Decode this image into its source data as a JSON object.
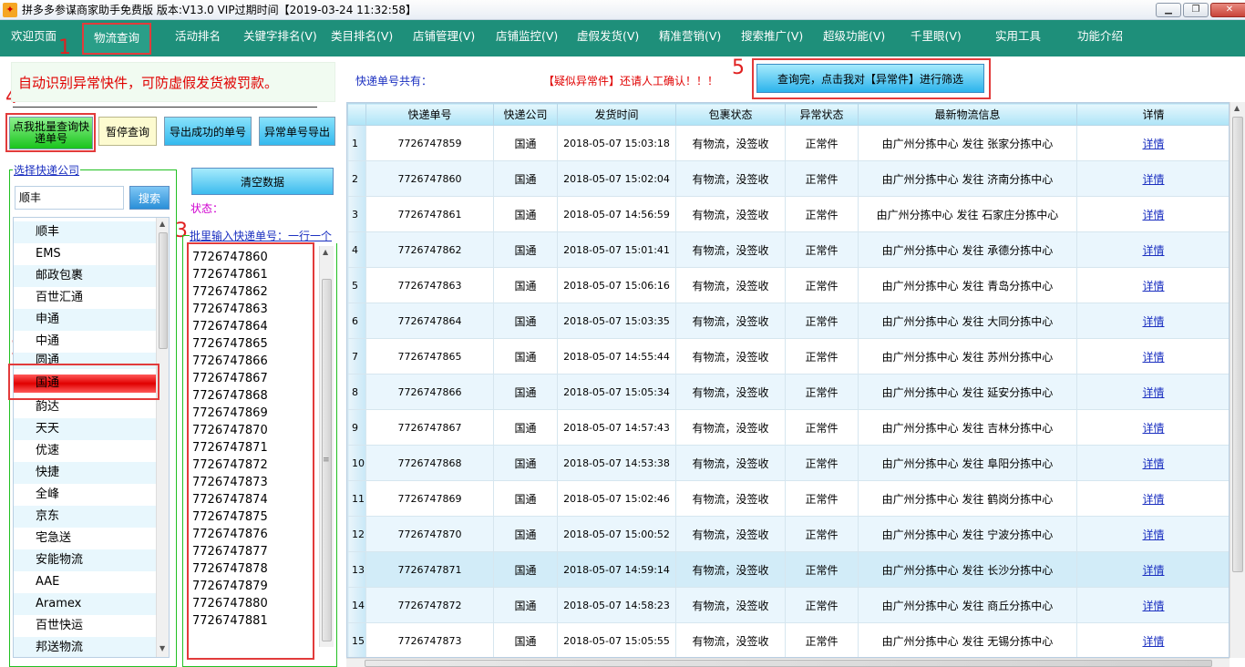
{
  "window": {
    "title": "拼多多参谋商家助手免费版 版本:V13.0 VIP过期时间【2019-03-24 11:32:58】",
    "icon": "app-icon"
  },
  "menu": {
    "items": [
      "欢迎页面",
      "物流查询",
      "活动排名",
      "关键字排名(V)",
      "类目排名(V)",
      "店铺管理(V)",
      "店铺监控(V)",
      "虚假发货(V)",
      "精准营销(V)",
      "搜索推广(V)",
      "超级功能(V)",
      "千里眼(V)",
      "实用工具",
      "功能介绍"
    ],
    "active": "物流查询"
  },
  "markers": [
    "1",
    "2",
    "3",
    "4",
    "5"
  ],
  "tip": "自动识别异常快件，可防虚假发货被罚款。",
  "buttons": {
    "batch_query": "点我批量查询快递单号",
    "pause": "暂停查询",
    "export_success": "导出成功的单号",
    "export_abnormal": "异常单号导出",
    "clear": "清空数据",
    "search": "搜索",
    "filter": "查询完，点击我对【异常件】进行筛选"
  },
  "courier_group": {
    "label": "选择快递公司",
    "search_value": "顺丰",
    "items": [
      "顺丰",
      "EMS",
      "邮政包裹",
      "百世汇通",
      "申通",
      "中通",
      "圆通",
      "国通",
      "韵达",
      "天天",
      "优速",
      "快捷",
      "全峰",
      "京东",
      "宅急送",
      "安能物流",
      "AAE",
      "Aramex",
      "百世快运",
      "邦送物流"
    ],
    "selected": "国通"
  },
  "status_label": "状态：",
  "input_group": {
    "label": "批里输入快递单号：一行一个",
    "numbers": [
      "7726747860",
      "7726747861",
      "7726747862",
      "7726747863",
      "7726747864",
      "7726747865",
      "7726747866",
      "7726747867",
      "7726747868",
      "7726747869",
      "7726747870",
      "7726747871",
      "7726747872",
      "7726747873",
      "7726747874",
      "7726747875",
      "7726747876",
      "7726747877",
      "7726747878",
      "7726747879",
      "7726747880",
      "7726747881"
    ]
  },
  "count_label": "快递单号共有：",
  "warning": "【疑似异常件】还请人工确认！！！",
  "table": {
    "headers": [
      "",
      "快递单号",
      "快递公司",
      "发货时间",
      "包裹状态",
      "异常状态",
      "最新物流信息",
      "详情"
    ],
    "rows": [
      [
        "1",
        "7726747859",
        "国通",
        "2018-05-07 15:03:18",
        "有物流，没签收",
        "正常件",
        "由广州分拣中心 发往 张家分拣中心",
        "详情"
      ],
      [
        "2",
        "7726747860",
        "国通",
        "2018-05-07 15:02:04",
        "有物流，没签收",
        "正常件",
        "由广州分拣中心 发往 济南分拣中心",
        "详情"
      ],
      [
        "3",
        "7726747861",
        "国通",
        "2018-05-07 14:56:59",
        "有物流，没签收",
        "正常件",
        "由广州分拣中心 发往 石家庄分拣中心",
        "详情"
      ],
      [
        "4",
        "7726747862",
        "国通",
        "2018-05-07 15:01:41",
        "有物流，没签收",
        "正常件",
        "由广州分拣中心 发往 承德分拣中心",
        "详情"
      ],
      [
        "5",
        "7726747863",
        "国通",
        "2018-05-07 15:06:16",
        "有物流，没签收",
        "正常件",
        "由广州分拣中心 发往 青岛分拣中心",
        "详情"
      ],
      [
        "6",
        "7726747864",
        "国通",
        "2018-05-07 15:03:35",
        "有物流，没签收",
        "正常件",
        "由广州分拣中心 发往 大同分拣中心",
        "详情"
      ],
      [
        "7",
        "7726747865",
        "国通",
        "2018-05-07 14:55:44",
        "有物流，没签收",
        "正常件",
        "由广州分拣中心 发往 苏州分拣中心",
        "详情"
      ],
      [
        "8",
        "7726747866",
        "国通",
        "2018-05-07 15:05:34",
        "有物流，没签收",
        "正常件",
        "由广州分拣中心 发往 延安分拣中心",
        "详情"
      ],
      [
        "9",
        "7726747867",
        "国通",
        "2018-05-07 14:57:43",
        "有物流，没签收",
        "正常件",
        "由广州分拣中心 发往 吉林分拣中心",
        "详情"
      ],
      [
        "10",
        "7726747868",
        "国通",
        "2018-05-07 14:53:38",
        "有物流，没签收",
        "正常件",
        "由广州分拣中心 发往 阜阳分拣中心",
        "详情"
      ],
      [
        "11",
        "7726747869",
        "国通",
        "2018-05-07 15:02:46",
        "有物流，没签收",
        "正常件",
        "由广州分拣中心 发往 鹤岗分拣中心",
        "详情"
      ],
      [
        "12",
        "7726747870",
        "国通",
        "2018-05-07 15:00:52",
        "有物流，没签收",
        "正常件",
        "由广州分拣中心 发往 宁波分拣中心",
        "详情"
      ],
      [
        "13",
        "7726747871",
        "国通",
        "2018-05-07 14:59:14",
        "有物流，没签收",
        "正常件",
        "由广州分拣中心 发往 长沙分拣中心",
        "详情"
      ],
      [
        "14",
        "7726747872",
        "国通",
        "2018-05-07 14:58:23",
        "有物流，没签收",
        "正常件",
        "由广州分拣中心 发往 商丘分拣中心",
        "详情"
      ],
      [
        "15",
        "7726747873",
        "国通",
        "2018-05-07 15:05:55",
        "有物流，没签收",
        "正常件",
        "由广州分拣中心 发往 无锡分拣中心",
        "详情"
      ]
    ],
    "highlighted_row": "13"
  },
  "colors": {
    "menu_bg": "#1e8f7a",
    "marker": "#e02020",
    "selected": "#e00000",
    "link": "#1a2fc0"
  }
}
